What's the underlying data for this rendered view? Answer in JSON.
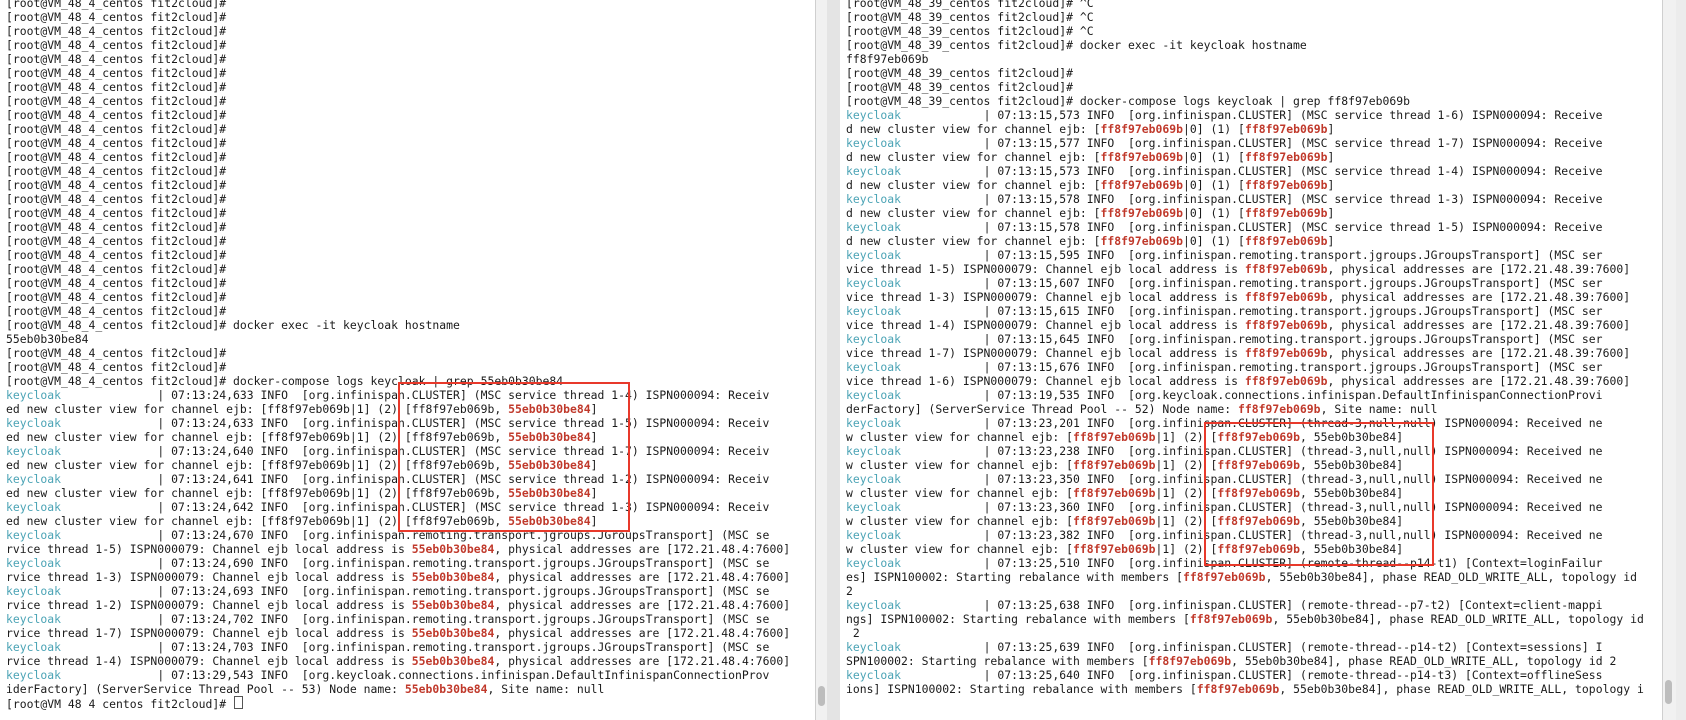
{
  "left_terminal": {
    "lines": [
      [
        {
          "t": "[root@VM_48_4_centos fit2cloud]#"
        }
      ],
      [
        {
          "t": "[root@VM_48_4_centos fit2cloud]#"
        }
      ],
      [
        {
          "t": "[root@VM_48_4_centos fit2cloud]#"
        }
      ],
      [
        {
          "t": "[root@VM_48_4_centos fit2cloud]#"
        }
      ],
      [
        {
          "t": "[root@VM_48_4_centos fit2cloud]#"
        }
      ],
      [
        {
          "t": "[root@VM_48_4_centos fit2cloud]#"
        }
      ],
      [
        {
          "t": "[root@VM_48_4_centos fit2cloud]#"
        }
      ],
      [
        {
          "t": "[root@VM_48_4_centos fit2cloud]#"
        }
      ],
      [
        {
          "t": "[root@VM_48_4_centos fit2cloud]#"
        }
      ],
      [
        {
          "t": "[root@VM_48_4_centos fit2cloud]#"
        }
      ],
      [
        {
          "t": "[root@VM_48_4_centos fit2cloud]#"
        }
      ],
      [
        {
          "t": "[root@VM_48_4_centos fit2cloud]#"
        }
      ],
      [
        {
          "t": "[root@VM_48_4_centos fit2cloud]#"
        }
      ],
      [
        {
          "t": "[root@VM_48_4_centos fit2cloud]#"
        }
      ],
      [
        {
          "t": "[root@VM_48_4_centos fit2cloud]#"
        }
      ],
      [
        {
          "t": "[root@VM_48_4_centos fit2cloud]#"
        }
      ],
      [
        {
          "t": "[root@VM_48_4_centos fit2cloud]#"
        }
      ],
      [
        {
          "t": "[root@VM_48_4_centos fit2cloud]#"
        }
      ],
      [
        {
          "t": "[root@VM_48_4_centos fit2cloud]#"
        }
      ],
      [
        {
          "t": "[root@VM_48_4_centos fit2cloud]#"
        }
      ],
      [
        {
          "t": "[root@VM_48_4_centos fit2cloud]#"
        }
      ],
      [
        {
          "t": "[root@VM_48_4_centos fit2cloud]#"
        }
      ],
      [
        {
          "t": "[root@VM_48_4_centos fit2cloud]#"
        }
      ],
      [
        {
          "t": "[root@VM_48_4_centos fit2cloud]# docker exec -it keycloak hostname"
        }
      ],
      [
        {
          "t": "55eb0b30be84"
        }
      ],
      [
        {
          "t": "[root@VM_48_4_centos fit2cloud]#"
        }
      ],
      [
        {
          "t": "[root@VM_48_4_centos fit2cloud]#"
        }
      ],
      [
        {
          "t": "[root@VM_48_4_centos fit2cloud]# docker-compose logs keycloak | grep 55eb0b30be84"
        }
      ],
      [
        {
          "t": "keycloak",
          "c": "svc"
        },
        {
          "t": "              | 07:13:24,633 INFO  [org.infinispan.CLUSTER] (MSC service thread 1-4) ISPN000094: Receiv"
        }
      ],
      [
        {
          "t": "ed new cluster view for channel ejb: [ff8f97eb069b|1] (2) [ff8f97eb069b, "
        },
        {
          "t": "55eb0b30be84",
          "c": "hl"
        },
        {
          "t": "]"
        }
      ],
      [
        {
          "t": "keycloak",
          "c": "svc"
        },
        {
          "t": "              | 07:13:24,633 INFO  [org.infinispan.CLUSTER] (MSC service thread 1-5) ISPN000094: Receiv"
        }
      ],
      [
        {
          "t": "ed new cluster view for channel ejb: [ff8f97eb069b|1] (2) [ff8f97eb069b, "
        },
        {
          "t": "55eb0b30be84",
          "c": "hl"
        },
        {
          "t": "]"
        }
      ],
      [
        {
          "t": "keycloak",
          "c": "svc"
        },
        {
          "t": "              | 07:13:24,640 INFO  [org.infinispan.CLUSTER] (MSC service thread 1-7) ISPN000094: Receiv"
        }
      ],
      [
        {
          "t": "ed new cluster view for channel ejb: [ff8f97eb069b|1] (2) [ff8f97eb069b, "
        },
        {
          "t": "55eb0b30be84",
          "c": "hl"
        },
        {
          "t": "]"
        }
      ],
      [
        {
          "t": "keycloak",
          "c": "svc"
        },
        {
          "t": "              | 07:13:24,641 INFO  [org.infinispan.CLUSTER] (MSC service thread 1-2) ISPN000094: Receiv"
        }
      ],
      [
        {
          "t": "ed new cluster view for channel ejb: [ff8f97eb069b|1] (2) [ff8f97eb069b, "
        },
        {
          "t": "55eb0b30be84",
          "c": "hl"
        },
        {
          "t": "]"
        }
      ],
      [
        {
          "t": "keycloak",
          "c": "svc"
        },
        {
          "t": "              | 07:13:24,642 INFO  [org.infinispan.CLUSTER] (MSC service thread 1-3) ISPN000094: Receiv"
        }
      ],
      [
        {
          "t": "ed new cluster view for channel ejb: [ff8f97eb069b|1] (2) [ff8f97eb069b, "
        },
        {
          "t": "55eb0b30be84",
          "c": "hl"
        },
        {
          "t": "]"
        }
      ],
      [
        {
          "t": "keycloak",
          "c": "svc"
        },
        {
          "t": "              | 07:13:24,670 INFO  [org.infinispan.remoting.transport.jgroups.JGroupsTransport] (MSC se"
        }
      ],
      [
        {
          "t": "rvice thread 1-5) ISPN000079: Channel ejb local address is "
        },
        {
          "t": "55eb0b30be84",
          "c": "hl"
        },
        {
          "t": ", physical addresses are [172.21.48.4:7600]"
        }
      ],
      [
        {
          "t": "keycloak",
          "c": "svc"
        },
        {
          "t": "              | 07:13:24,690 INFO  [org.infinispan.remoting.transport.jgroups.JGroupsTransport] (MSC se"
        }
      ],
      [
        {
          "t": "rvice thread 1-3) ISPN000079: Channel ejb local address is "
        },
        {
          "t": "55eb0b30be84",
          "c": "hl"
        },
        {
          "t": ", physical addresses are [172.21.48.4:7600]"
        }
      ],
      [
        {
          "t": "keycloak",
          "c": "svc"
        },
        {
          "t": "              | 07:13:24,693 INFO  [org.infinispan.remoting.transport.jgroups.JGroupsTransport] (MSC se"
        }
      ],
      [
        {
          "t": "rvice thread 1-2) ISPN000079: Channel ejb local address is "
        },
        {
          "t": "55eb0b30be84",
          "c": "hl"
        },
        {
          "t": ", physical addresses are [172.21.48.4:7600]"
        }
      ],
      [
        {
          "t": "keycloak",
          "c": "svc"
        },
        {
          "t": "              | 07:13:24,702 INFO  [org.infinispan.remoting.transport.jgroups.JGroupsTransport] (MSC se"
        }
      ],
      [
        {
          "t": "rvice thread 1-7) ISPN000079: Channel ejb local address is "
        },
        {
          "t": "55eb0b30be84",
          "c": "hl"
        },
        {
          "t": ", physical addresses are [172.21.48.4:7600]"
        }
      ],
      [
        {
          "t": "keycloak",
          "c": "svc"
        },
        {
          "t": "              | 07:13:24,703 INFO  [org.infinispan.remoting.transport.jgroups.JGroupsTransport] (MSC se"
        }
      ],
      [
        {
          "t": "rvice thread 1-4) ISPN000079: Channel ejb local address is "
        },
        {
          "t": "55eb0b30be84",
          "c": "hl"
        },
        {
          "t": ", physical addresses are [172.21.48.4:7600]"
        }
      ],
      [
        {
          "t": "keycloak",
          "c": "svc"
        },
        {
          "t": "              | 07:13:29,543 INFO  [org.keycloak.connections.infinispan.DefaultInfinispanConnectionProv"
        }
      ],
      [
        {
          "t": "iderFactory] (ServerService Thread Pool -- 53) Node name: "
        },
        {
          "t": "55eb0b30be84",
          "c": "hl"
        },
        {
          "t": ", Site name: null"
        }
      ],
      [
        {
          "t": "[root@VM_48_4_centos fit2cloud]# "
        },
        {
          "t": "",
          "c": "cursor"
        }
      ]
    ]
  },
  "right_terminal": {
    "lines": [
      [
        {
          "t": "[root@VM_48_39_centos fit2cloud]# ^C"
        }
      ],
      [
        {
          "t": "[root@VM_48_39_centos fit2cloud]# ^C"
        }
      ],
      [
        {
          "t": "[root@VM_48_39_centos fit2cloud]# ^C"
        }
      ],
      [
        {
          "t": "[root@VM_48_39_centos fit2cloud]# docker exec -it keycloak hostname"
        }
      ],
      [
        {
          "t": "ff8f97eb069b"
        }
      ],
      [
        {
          "t": "[root@VM_48_39_centos fit2cloud]#"
        }
      ],
      [
        {
          "t": "[root@VM_48_39_centos fit2cloud]#"
        }
      ],
      [
        {
          "t": "[root@VM_48_39_centos fit2cloud]# docker-compose logs keycloak | grep ff8f97eb069b"
        }
      ],
      [
        {
          "t": "keycloak",
          "c": "svc"
        },
        {
          "t": "            | 07:13:15,573 INFO  [org.infinispan.CLUSTER] (MSC service thread 1-6) ISPN000094: Receive"
        }
      ],
      [
        {
          "t": "d new cluster view for channel ejb: ["
        },
        {
          "t": "ff8f97eb069b",
          "c": "hl"
        },
        {
          "t": "|0] (1) ["
        },
        {
          "t": "ff8f97eb069b",
          "c": "hl"
        },
        {
          "t": "]"
        }
      ],
      [
        {
          "t": "keycloak",
          "c": "svc"
        },
        {
          "t": "            | 07:13:15,577 INFO  [org.infinispan.CLUSTER] (MSC service thread 1-7) ISPN000094: Receive"
        }
      ],
      [
        {
          "t": "d new cluster view for channel ejb: ["
        },
        {
          "t": "ff8f97eb069b",
          "c": "hl"
        },
        {
          "t": "|0] (1) ["
        },
        {
          "t": "ff8f97eb069b",
          "c": "hl"
        },
        {
          "t": "]"
        }
      ],
      [
        {
          "t": "keycloak",
          "c": "svc"
        },
        {
          "t": "            | 07:13:15,573 INFO  [org.infinispan.CLUSTER] (MSC service thread 1-4) ISPN000094: Receive"
        }
      ],
      [
        {
          "t": "d new cluster view for channel ejb: ["
        },
        {
          "t": "ff8f97eb069b",
          "c": "hl"
        },
        {
          "t": "|0] (1) ["
        },
        {
          "t": "ff8f97eb069b",
          "c": "hl"
        },
        {
          "t": "]"
        }
      ],
      [
        {
          "t": "keycloak",
          "c": "svc"
        },
        {
          "t": "            | 07:13:15,578 INFO  [org.infinispan.CLUSTER] (MSC service thread 1-3) ISPN000094: Receive"
        }
      ],
      [
        {
          "t": "d new cluster view for channel ejb: ["
        },
        {
          "t": "ff8f97eb069b",
          "c": "hl"
        },
        {
          "t": "|0] (1) ["
        },
        {
          "t": "ff8f97eb069b",
          "c": "hl"
        },
        {
          "t": "]"
        }
      ],
      [
        {
          "t": "keycloak",
          "c": "svc"
        },
        {
          "t": "            | 07:13:15,578 INFO  [org.infinispan.CLUSTER] (MSC service thread 1-5) ISPN000094: Receive"
        }
      ],
      [
        {
          "t": "d new cluster view for channel ejb: ["
        },
        {
          "t": "ff8f97eb069b",
          "c": "hl"
        },
        {
          "t": "|0] (1) ["
        },
        {
          "t": "ff8f97eb069b",
          "c": "hl"
        },
        {
          "t": "]"
        }
      ],
      [
        {
          "t": "keycloak",
          "c": "svc"
        },
        {
          "t": "            | 07:13:15,595 INFO  [org.infinispan.remoting.transport.jgroups.JGroupsTransport] (MSC ser"
        }
      ],
      [
        {
          "t": "vice thread 1-5) ISPN000079: Channel ejb local address is "
        },
        {
          "t": "ff8f97eb069b",
          "c": "hl"
        },
        {
          "t": ", physical addresses are [172.21.48.39:7600]"
        }
      ],
      [
        {
          "t": "keycloak",
          "c": "svc"
        },
        {
          "t": "            | 07:13:15,607 INFO  [org.infinispan.remoting.transport.jgroups.JGroupsTransport] (MSC ser"
        }
      ],
      [
        {
          "t": "vice thread 1-3) ISPN000079: Channel ejb local address is "
        },
        {
          "t": "ff8f97eb069b",
          "c": "hl"
        },
        {
          "t": ", physical addresses are [172.21.48.39:7600]"
        }
      ],
      [
        {
          "t": "keycloak",
          "c": "svc"
        },
        {
          "t": "            | 07:13:15,615 INFO  [org.infinispan.remoting.transport.jgroups.JGroupsTransport] (MSC ser"
        }
      ],
      [
        {
          "t": "vice thread 1-4) ISPN000079: Channel ejb local address is "
        },
        {
          "t": "ff8f97eb069b",
          "c": "hl"
        },
        {
          "t": ", physical addresses are [172.21.48.39:7600]"
        }
      ],
      [
        {
          "t": "keycloak",
          "c": "svc"
        },
        {
          "t": "            | 07:13:15,645 INFO  [org.infinispan.remoting.transport.jgroups.JGroupsTransport] (MSC ser"
        }
      ],
      [
        {
          "t": "vice thread 1-7) ISPN000079: Channel ejb local address is "
        },
        {
          "t": "ff8f97eb069b",
          "c": "hl"
        },
        {
          "t": ", physical addresses are [172.21.48.39:7600]"
        }
      ],
      [
        {
          "t": "keycloak",
          "c": "svc"
        },
        {
          "t": "            | 07:13:15,676 INFO  [org.infinispan.remoting.transport.jgroups.JGroupsTransport] (MSC ser"
        }
      ],
      [
        {
          "t": "vice thread 1-6) ISPN000079: Channel ejb local address is "
        },
        {
          "t": "ff8f97eb069b",
          "c": "hl"
        },
        {
          "t": ", physical addresses are [172.21.48.39:7600]"
        }
      ],
      [
        {
          "t": "keycloak",
          "c": "svc"
        },
        {
          "t": "            | 07:13:19,535 INFO  [org.keycloak.connections.infinispan.DefaultInfinispanConnectionProvi"
        }
      ],
      [
        {
          "t": "derFactory] (ServerService Thread Pool -- 52) Node name: "
        },
        {
          "t": "ff8f97eb069b",
          "c": "hl"
        },
        {
          "t": ", Site name: null"
        }
      ],
      [
        {
          "t": "keycloak",
          "c": "svc"
        },
        {
          "t": "            | 07:13:23,201 INFO  [org.infinispan.CLUSTER] (thread-3,null,null) ISPN000094: Received ne"
        }
      ],
      [
        {
          "t": "w cluster view for channel ejb: ["
        },
        {
          "t": "ff8f97eb069b",
          "c": "hl"
        },
        {
          "t": "|1] (2) ["
        },
        {
          "t": "ff8f97eb069b",
          "c": "hl"
        },
        {
          "t": ", 55eb0b30be84]"
        }
      ],
      [
        {
          "t": "keycloak",
          "c": "svc"
        },
        {
          "t": "            | 07:13:23,238 INFO  [org.infinispan.CLUSTER] (thread-3,null,null) ISPN000094: Received ne"
        }
      ],
      [
        {
          "t": "w cluster view for channel ejb: ["
        },
        {
          "t": "ff8f97eb069b",
          "c": "hl"
        },
        {
          "t": "|1] (2) ["
        },
        {
          "t": "ff8f97eb069b",
          "c": "hl"
        },
        {
          "t": ", 55eb0b30be84]"
        }
      ],
      [
        {
          "t": "keycloak",
          "c": "svc"
        },
        {
          "t": "            | 07:13:23,350 INFO  [org.infinispan.CLUSTER] (thread-3,null,null) ISPN000094: Received ne"
        }
      ],
      [
        {
          "t": "w cluster view for channel ejb: ["
        },
        {
          "t": "ff8f97eb069b",
          "c": "hl"
        },
        {
          "t": "|1] (2) ["
        },
        {
          "t": "ff8f97eb069b",
          "c": "hl"
        },
        {
          "t": ", 55eb0b30be84]"
        }
      ],
      [
        {
          "t": "keycloak",
          "c": "svc"
        },
        {
          "t": "            | 07:13:23,360 INFO  [org.infinispan.CLUSTER] (thread-3,null,null) ISPN000094: Received ne"
        }
      ],
      [
        {
          "t": "w cluster view for channel ejb: ["
        },
        {
          "t": "ff8f97eb069b",
          "c": "hl"
        },
        {
          "t": "|1] (2) ["
        },
        {
          "t": "ff8f97eb069b",
          "c": "hl"
        },
        {
          "t": ", 55eb0b30be84]"
        }
      ],
      [
        {
          "t": "keycloak",
          "c": "svc"
        },
        {
          "t": "            | 07:13:23,382 INFO  [org.infinispan.CLUSTER] (thread-3,null,null) ISPN000094: Received ne"
        }
      ],
      [
        {
          "t": "w cluster view for channel ejb: ["
        },
        {
          "t": "ff8f97eb069b",
          "c": "hl"
        },
        {
          "t": "|1] (2) ["
        },
        {
          "t": "ff8f97eb069b",
          "c": "hl"
        },
        {
          "t": ", 55eb0b30be84]"
        }
      ],
      [
        {
          "t": "keycloak",
          "c": "svc"
        },
        {
          "t": "            | 07:13:25,510 INFO  [org.infinispan.CLUSTER] (remote-thread--p14-t1) [Context=loginFailur"
        }
      ],
      [
        {
          "t": "es] ISPN100002: Starting rebalance with members ["
        },
        {
          "t": "ff8f97eb069b",
          "c": "hl"
        },
        {
          "t": ", 55eb0b30be84], phase READ_OLD_WRITE_ALL, topology id"
        }
      ],
      [
        {
          "t": "2"
        }
      ],
      [
        {
          "t": "keycloak",
          "c": "svc"
        },
        {
          "t": "            | 07:13:25,638 INFO  [org.infinispan.CLUSTER] (remote-thread--p7-t2) [Context=client-mappi"
        }
      ],
      [
        {
          "t": "ngs] ISPN100002: Starting rebalance with members ["
        },
        {
          "t": "ff8f97eb069b",
          "c": "hl"
        },
        {
          "t": ", 55eb0b30be84], phase READ_OLD_WRITE_ALL, topology id"
        }
      ],
      [
        {
          "t": " 2"
        }
      ],
      [
        {
          "t": "keycloak",
          "c": "svc"
        },
        {
          "t": "            | 07:13:25,639 INFO  [org.infinispan.CLUSTER] (remote-thread--p14-t2) [Context=sessions] I"
        }
      ],
      [
        {
          "t": "SPN100002: Starting rebalance with members ["
        },
        {
          "t": "ff8f97eb069b",
          "c": "hl"
        },
        {
          "t": ", 55eb0b30be84], phase READ_OLD_WRITE_ALL, topology id 2"
        }
      ],
      [
        {
          "t": "keycloak",
          "c": "svc"
        },
        {
          "t": "            | 07:13:25,640 INFO  [org.infinispan.CLUSTER] (remote-thread--p14-t3) [Context=offlineSess"
        }
      ],
      [
        {
          "t": "ions] ISPN100002: Starting rebalance with members ["
        },
        {
          "t": "ff8f97eb069b",
          "c": "hl"
        },
        {
          "t": ", 55eb0b30be84], phase READ_OLD_WRITE_ALL, topology i"
        }
      ]
    ]
  },
  "colors": {
    "service_name": "#4aa3b5",
    "highlight": "#c0392b",
    "annotation_box": "#e8392b"
  }
}
